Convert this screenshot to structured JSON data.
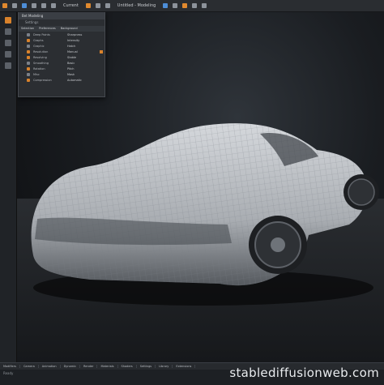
{
  "window": {
    "title": "Untitled - Modeling"
  },
  "toolbar": {
    "mode_label": "Current"
  },
  "panel": {
    "title": "Bet Modeling",
    "subtitle": "Settings",
    "columns": [
      "Selection",
      "Preferences",
      "Background"
    ],
    "rows": [
      {
        "label": "Deep Points",
        "value": "Sharpness"
      },
      {
        "label": "Graphs",
        "value": "Intensity"
      },
      {
        "label": "Graphic",
        "value": "Hatch"
      },
      {
        "label": "Resolution",
        "value": "Manual"
      },
      {
        "label": "Resolving",
        "value": "Stable"
      },
      {
        "label": "Smoothing",
        "value": "Basic"
      },
      {
        "label": "Rotation",
        "value": "Pitch"
      },
      {
        "label": "Misc",
        "value": "Mask"
      },
      {
        "label": "Compression",
        "value": "Automatic"
      }
    ]
  },
  "bottom": {
    "tabs": [
      "Modifiers",
      "Camera",
      "Animation",
      "Dynamic",
      "Render",
      "Materials",
      "Shaders",
      "Settings",
      "Library",
      "Extensions"
    ],
    "status": "Ready"
  },
  "watermark": "stablediffusionweb.com",
  "colors": {
    "accent": "#d9822b",
    "ui_bg": "#2b2e32",
    "viewport_bg": "#1a1d21"
  }
}
